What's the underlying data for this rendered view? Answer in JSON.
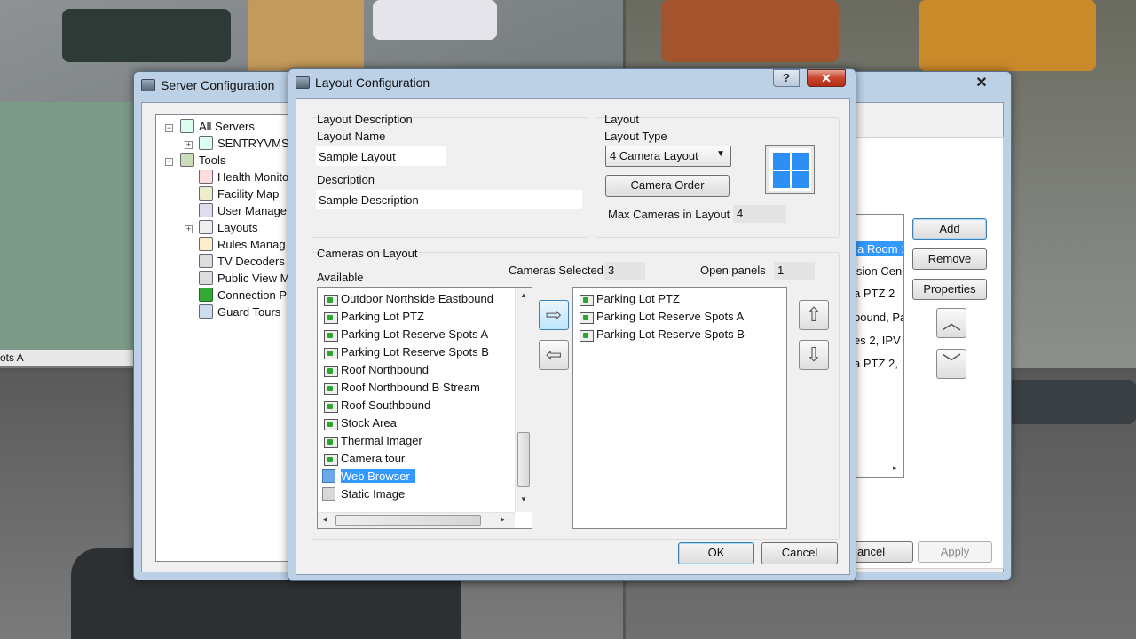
{
  "background": {
    "cam_label": "ots A"
  },
  "server_config": {
    "title": "Server Configuration",
    "close_glyph": "✕",
    "tree": [
      {
        "label": "All Servers",
        "icon": "server-group-icon"
      },
      {
        "label": "SENTRYVMS",
        "icon": "server-icon"
      },
      {
        "label": "Tools",
        "icon": "tools-icon"
      },
      {
        "label": "Health Monito",
        "icon": "health-icon"
      },
      {
        "label": "Facility Map",
        "icon": "map-icon"
      },
      {
        "label": "User Manage",
        "icon": "users-icon"
      },
      {
        "label": "Layouts",
        "icon": "layouts-icon"
      },
      {
        "label": "Rules Manag",
        "icon": "rules-icon"
      },
      {
        "label": "TV Decoders",
        "icon": "tv-icon"
      },
      {
        "label": "Public View M",
        "icon": "public-view-icon"
      },
      {
        "label": "Connection P",
        "icon": "connection-icon"
      },
      {
        "label": "Guard Tours",
        "icon": "guard-icon"
      }
    ],
    "right_list": [
      "a Room 1",
      "ision Cen",
      "a PTZ 2",
      "bound, Pa",
      "es 2, IPV",
      "a PTZ 2,"
    ],
    "buttons": {
      "add": "Add",
      "remove": "Remove",
      "properties": "Properties",
      "cancel": "ancel",
      "apply": "Apply"
    }
  },
  "layout_config": {
    "title": "Layout Configuration",
    "help_glyph": "?",
    "close_glyph": "✕",
    "layout_description": {
      "group_label": "Layout Description",
      "name_label": "Layout Name",
      "name_value": "Sample Layout",
      "description_label": "Description",
      "description_value": "Sample Description"
    },
    "layout": {
      "group_label": "Layout",
      "type_label": "Layout Type",
      "type_value": "4 Camera Layout",
      "camera_order_button": "Camera Order",
      "max_label": "Max Cameras in Layout",
      "max_value": "4"
    },
    "cameras": {
      "group_label": "Cameras on Layout",
      "available_label": "Available",
      "selected_label": "Cameras Selected",
      "selected_value": "3",
      "open_panels_label": "Open panels",
      "open_panels_value": "1",
      "available": [
        {
          "label": "Outdoor Northside Eastbound",
          "type": "camera"
        },
        {
          "label": "Parking Lot PTZ",
          "type": "camera"
        },
        {
          "label": "Parking Lot Reserve Spots A",
          "type": "camera"
        },
        {
          "label": "Parking Lot Reserve Spots B",
          "type": "camera"
        },
        {
          "label": "Roof Northbound",
          "type": "camera"
        },
        {
          "label": "Roof Northbound B Stream",
          "type": "camera"
        },
        {
          "label": "Roof Southbound",
          "type": "camera"
        },
        {
          "label": "Stock Area",
          "type": "camera"
        },
        {
          "label": "Thermal Imager",
          "type": "camera"
        },
        {
          "label": "Camera tour",
          "type": "camera"
        },
        {
          "label": "Web Browser",
          "type": "square",
          "selected": true
        },
        {
          "label": "Static Image",
          "type": "square"
        }
      ],
      "selected": [
        {
          "label": "Parking Lot PTZ"
        },
        {
          "label": "Parking Lot Reserve Spots A"
        },
        {
          "label": "Parking Lot Reserve Spots B"
        }
      ]
    },
    "buttons": {
      "ok": "OK",
      "cancel": "Cancel"
    },
    "colors": {
      "accent": "#3399ff",
      "grid_blue": "#2c8ff5"
    }
  }
}
